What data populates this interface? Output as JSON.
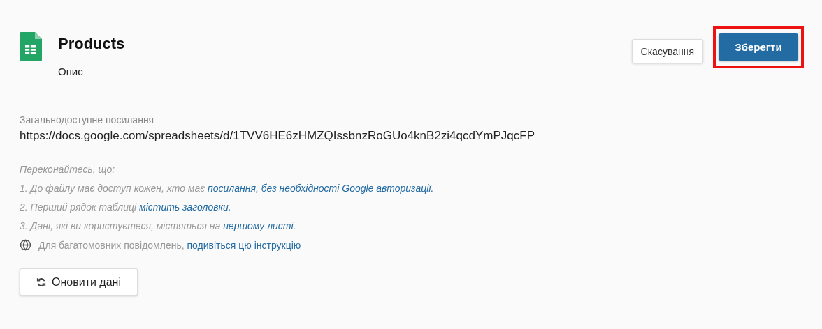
{
  "header": {
    "title": "Products",
    "description": "Опис"
  },
  "actions": {
    "cancel": "Скасування",
    "save": {
      "label": "Зберегти",
      "highlighted": true
    }
  },
  "public_link": {
    "label": "Загальнодоступне посилання",
    "url": "https://docs.google.com/spreadsheets/d/1TVV6HE6zHMZQIssbnzRoGUo4knB2zi4qcdYmPJqcFP"
  },
  "checklist": {
    "intro": "Переконайтесь, що:",
    "items": [
      {
        "text": "1. До файлу має доступ кожен, хто має ",
        "link": "посилання, без необхідності Google авторизації."
      },
      {
        "text": "2. Перший рядок таблиці ",
        "link": "містить заголовки."
      },
      {
        "text": "3. Дані, які ви користуєтеся, містяться на ",
        "link": "першому листі."
      }
    ]
  },
  "multilingual_note": {
    "text": "Для багатомовних повідомлень, ",
    "link": "подивіться цю інструкцію"
  },
  "refresh_button": "Оновити дані"
}
